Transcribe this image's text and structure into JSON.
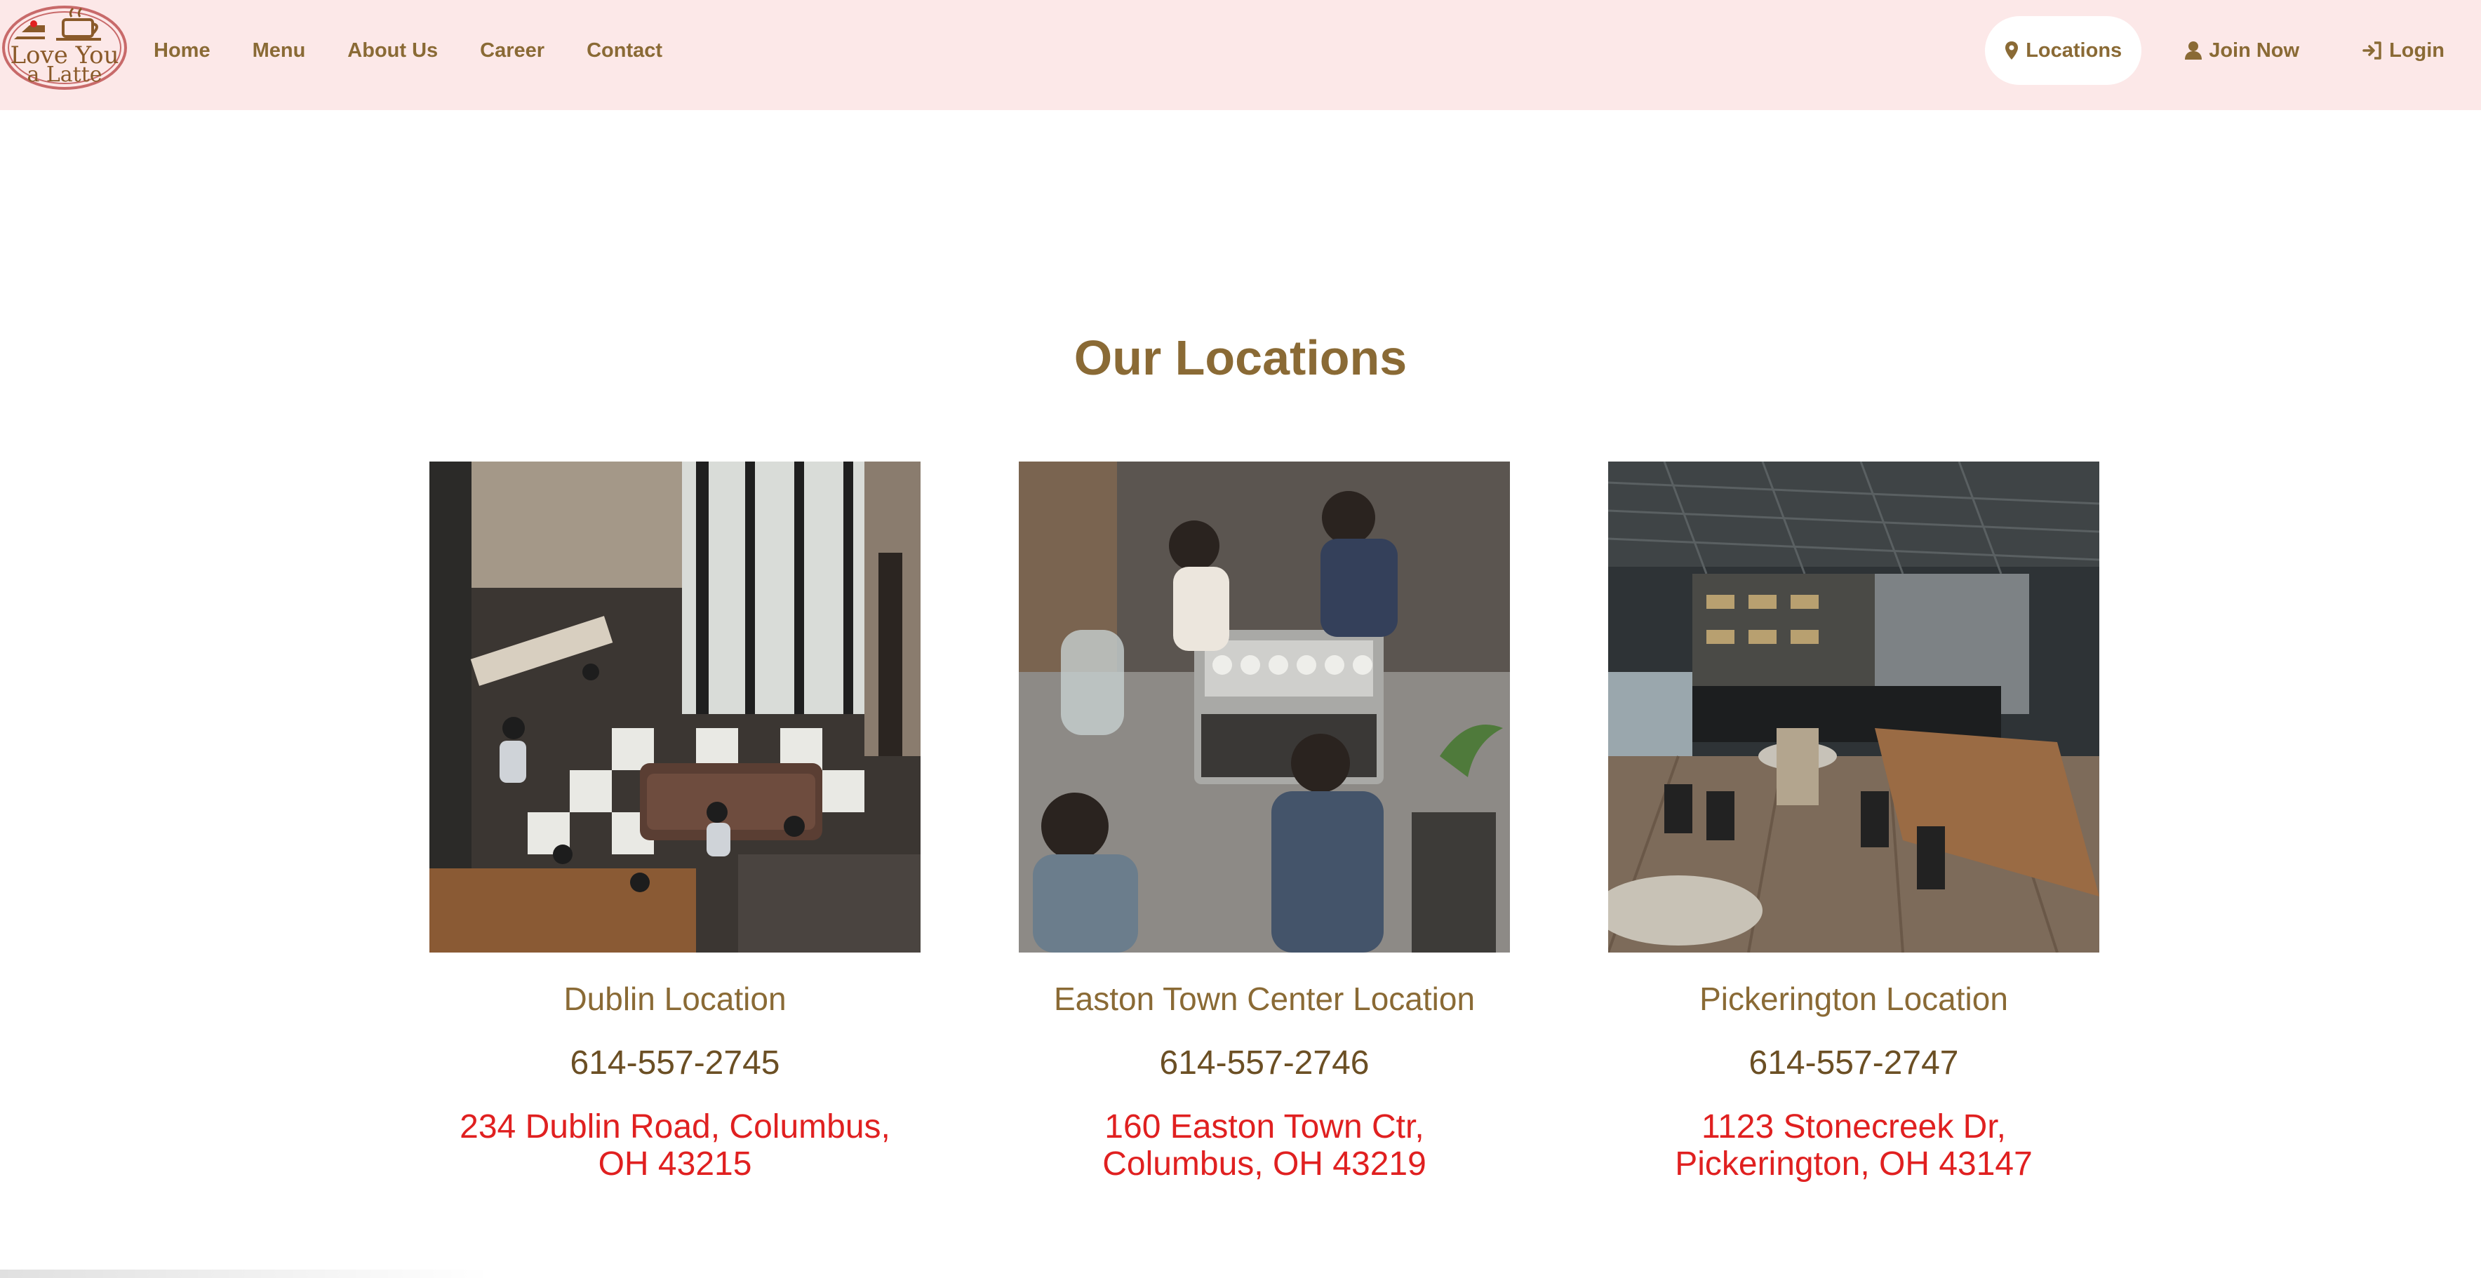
{
  "brand": {
    "logo_line1": "Love You",
    "logo_line2": "a Latte",
    "colors": {
      "nav_bg": "#fce8e8",
      "brand_brown": "#8a6a35",
      "address_red": "#e02020"
    }
  },
  "nav": {
    "left": [
      "Home",
      "Menu",
      "About Us",
      "Career",
      "Contact"
    ],
    "right": [
      {
        "label": "Locations",
        "icon": "map-pin-icon",
        "active": true
      },
      {
        "label": "Join Now",
        "icon": "user-icon",
        "active": false
      },
      {
        "label": "Login",
        "icon": "login-icon",
        "active": false
      }
    ]
  },
  "page": {
    "title": "Our Locations"
  },
  "locations": [
    {
      "name": "Dublin Location",
      "phone": "614-557-2745",
      "address_line1": "234 Dublin Road, Columbus,",
      "address_line2": "OH 43215",
      "image": "cafe-interior-overhead-photo"
    },
    {
      "name": "Easton Town Center Location",
      "phone": "614-557-2746",
      "address_line1": "160 Easton Town Ctr,",
      "address_line2": "Columbus, OH 43219",
      "image": "baristas-espresso-machine-photo"
    },
    {
      "name": "Pickerington Location",
      "phone": "614-557-2747",
      "address_line1": "1123 Stonecreek Dr,",
      "address_line2": "Pickerington, OH 43147",
      "image": "cafe-dining-room-photo"
    }
  ]
}
